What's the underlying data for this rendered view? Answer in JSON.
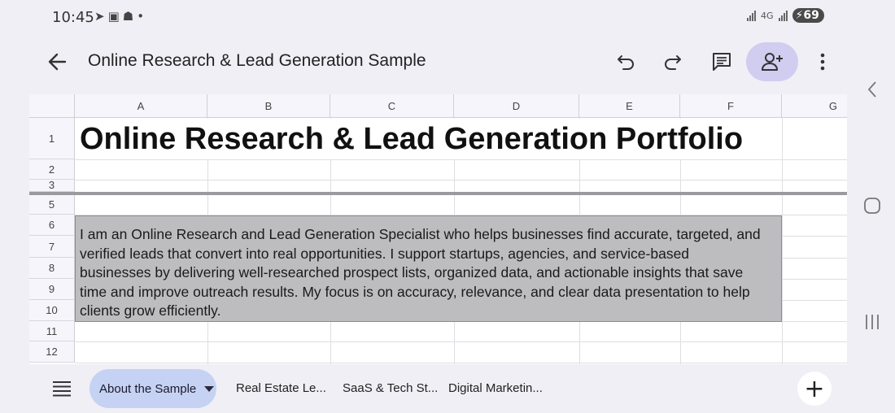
{
  "status_bar": {
    "time": "10:45",
    "icons": [
      "telegram-icon",
      "screenshot-icon",
      "snapchat-icon",
      "dot-icon"
    ],
    "network_label": "4G",
    "battery": "69"
  },
  "app_bar": {
    "title": "Online Research & Lead Generation Sample",
    "accent": "#d0cdf0"
  },
  "sheet": {
    "columns": [
      "A",
      "B",
      "C",
      "D",
      "E",
      "F",
      "G"
    ],
    "rows": [
      "1",
      "2",
      "3",
      "5",
      "6",
      "7",
      "8",
      "9",
      "10",
      "11",
      "12"
    ],
    "title_cell": "Online Research & Lead Generation Portfolio",
    "description_lines": [
      "I am an Online Research and Lead Generation Specialist who helps businesses find accurate, targeted, and",
      "verified leads that convert into real opportunities. I support startups, agencies, and service-based",
      "businesses by delivering well-researched prospect lists, organized data, and actionable insights that save",
      "time and improve outreach results. My focus is on accuracy, relevance, and clear data presentation to help",
      "clients grow efficiently."
    ],
    "description_fill": "#bdbcbf"
  },
  "tabs": {
    "active": "About the Sample",
    "others": [
      "Real Estate Le...",
      "SaaS & Tech St...",
      "Digital Marketin..."
    ],
    "active_color": "#c5d2f3"
  }
}
